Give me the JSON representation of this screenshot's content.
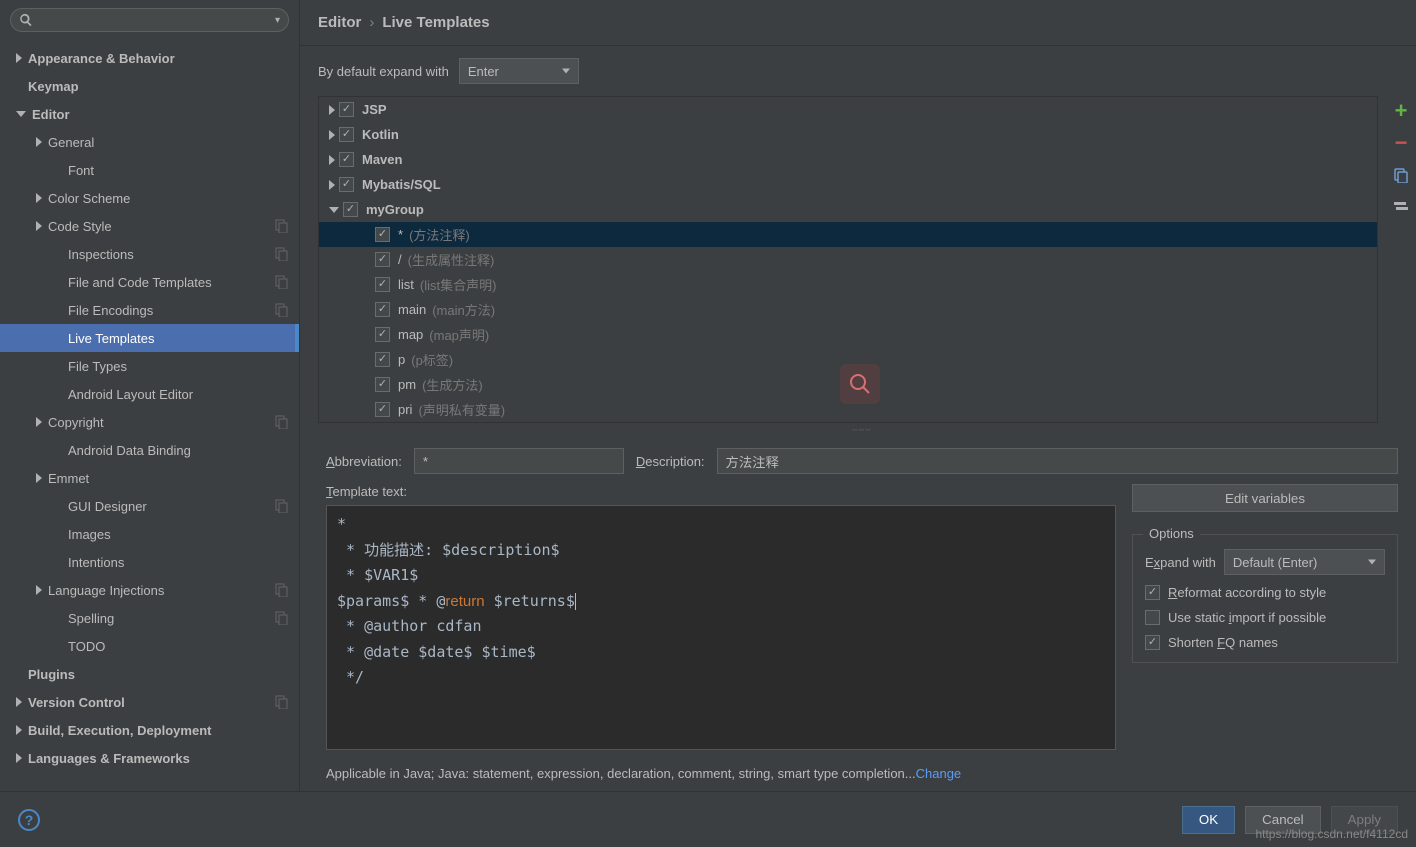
{
  "breadcrumb": {
    "parent": "Editor",
    "current": "Live Templates"
  },
  "sidebar": {
    "items": [
      {
        "label": "Appearance & Behavior",
        "level": 0,
        "bold": true,
        "arrow": "right"
      },
      {
        "label": "Keymap",
        "level": 0,
        "bold": true
      },
      {
        "label": "Editor",
        "level": 0,
        "bold": true,
        "arrow": "down"
      },
      {
        "label": "General",
        "level": 1,
        "arrow": "right"
      },
      {
        "label": "Font",
        "level": 2
      },
      {
        "label": "Color Scheme",
        "level": 1,
        "arrow": "right"
      },
      {
        "label": "Code Style",
        "level": 1,
        "arrow": "right",
        "copy": true
      },
      {
        "label": "Inspections",
        "level": 2,
        "copy": true
      },
      {
        "label": "File and Code Templates",
        "level": 2,
        "copy": true
      },
      {
        "label": "File Encodings",
        "level": 2,
        "copy": true
      },
      {
        "label": "Live Templates",
        "level": 2,
        "selected": true
      },
      {
        "label": "File Types",
        "level": 2
      },
      {
        "label": "Android Layout Editor",
        "level": 2
      },
      {
        "label": "Copyright",
        "level": 1,
        "arrow": "right",
        "copy": true
      },
      {
        "label": "Android Data Binding",
        "level": 2
      },
      {
        "label": "Emmet",
        "level": 1,
        "arrow": "right"
      },
      {
        "label": "GUI Designer",
        "level": 2,
        "copy": true
      },
      {
        "label": "Images",
        "level": 2
      },
      {
        "label": "Intentions",
        "level": 2
      },
      {
        "label": "Language Injections",
        "level": 1,
        "arrow": "right",
        "copy": true
      },
      {
        "label": "Spelling",
        "level": 2,
        "copy": true
      },
      {
        "label": "TODO",
        "level": 2
      },
      {
        "label": "Plugins",
        "level": 0,
        "bold": true
      },
      {
        "label": "Version Control",
        "level": 0,
        "bold": true,
        "arrow": "right",
        "copy": true
      },
      {
        "label": "Build, Execution, Deployment",
        "level": 0,
        "bold": true,
        "arrow": "right"
      },
      {
        "label": "Languages & Frameworks",
        "level": 0,
        "bold": true,
        "arrow": "right"
      }
    ]
  },
  "expand_row": {
    "label": "By default expand with",
    "value": "Enter"
  },
  "template_groups": [
    {
      "abbr": "JSP",
      "arrow": "right",
      "bold": true,
      "checked": true
    },
    {
      "abbr": "Kotlin",
      "arrow": "right",
      "bold": true,
      "checked": true
    },
    {
      "abbr": "Maven",
      "arrow": "right",
      "bold": true,
      "checked": true
    },
    {
      "abbr": "Mybatis/SQL",
      "arrow": "right",
      "bold": true,
      "checked": true
    },
    {
      "abbr": "myGroup",
      "arrow": "down",
      "bold": true,
      "checked": true
    }
  ],
  "my_group_items": [
    {
      "abbr": "*",
      "desc": "(方法注释)",
      "checked": true,
      "selected": true
    },
    {
      "abbr": "/",
      "desc": "(生成属性注释)",
      "checked": true
    },
    {
      "abbr": "list",
      "desc": "(list集合声明)",
      "checked": true
    },
    {
      "abbr": "main",
      "desc": "(main方法)",
      "checked": true
    },
    {
      "abbr": "map",
      "desc": "(map声明)",
      "checked": true
    },
    {
      "abbr": "p",
      "desc": "(p标签)",
      "checked": true
    },
    {
      "abbr": "pm",
      "desc": "(生成方法)",
      "checked": true
    },
    {
      "abbr": "pri",
      "desc": "(声明私有变量)",
      "checked": true
    }
  ],
  "fields": {
    "abbr_label": "Abbreviation:",
    "abbr_value": "*",
    "desc_label": "Description:",
    "desc_value": "方法注释"
  },
  "template_text": {
    "label": "Template text:",
    "lines_pre": "*\n * 功能描述: $description$\n * $VAR1$\n$params$ * @",
    "kw": "return",
    "lines_post_same": " $returns$",
    "lines_post": "\n * @author cdfan\n * @date $date$ $time$\n */"
  },
  "right": {
    "edit_vars": "Edit variables",
    "options_title": "Options",
    "expand_with_label": "Expand with",
    "expand_with_value": "Default (Enter)",
    "reformat": "Reformat according to style",
    "static_import": "Use static import if possible",
    "shorten_fq": "Shorten FQ names"
  },
  "applicable": {
    "text": "Applicable in Java; Java: statement, expression, declaration, comment, string, smart type completion...",
    "link": "Change"
  },
  "footer": {
    "ok": "OK",
    "cancel": "Cancel",
    "apply": "Apply"
  },
  "watermark": "https://blog.csdn.net/f4112cd"
}
